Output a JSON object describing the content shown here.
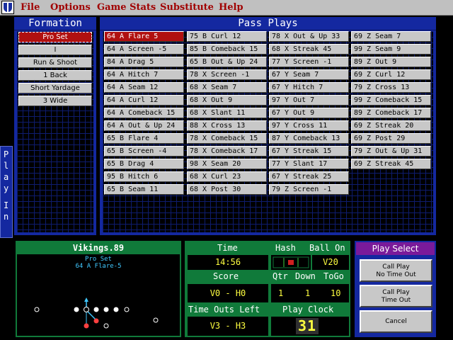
{
  "menu": {
    "items": [
      "File",
      "Options",
      "Game Stats",
      "Substitute",
      "Help"
    ]
  },
  "formation": {
    "title": "Formation",
    "items": [
      "Pro Set",
      "I",
      "Run & Shoot",
      "1 Back",
      "Short Yardage",
      "3 Wide"
    ],
    "selected_index": 0
  },
  "pass_plays": {
    "title": "Pass Plays",
    "columns": [
      [
        "64 A Flare 5",
        "64 A Screen -5",
        "84 A Drag 5",
        "64 A Hitch 7",
        "64 A Seam 12",
        "64 A Curl 12",
        "64 A Comeback 15",
        "64 A Out & Up 24",
        "65 B Flare 4",
        "65 B Screen -4",
        "65 B Drag 4",
        "95 B Hitch 6",
        "65 B Seam 11"
      ],
      [
        "75 B Curl 12",
        "85 B Comeback 15",
        "65 B Out & Up 24",
        "78 X Screen -1",
        "68 X Seam 7",
        "68 X Out 9",
        "68 X Slant 11",
        "88 X Cross 13",
        "78 X Comeback 15",
        "78 X Comeback 17",
        "98 X Seam 20",
        "68 X Curl 23",
        "68 X Post 30"
      ],
      [
        "78 X Out & Up 33",
        "68 X Streak 45",
        "77 Y Screen -1",
        "67 Y Seam 7",
        "67 Y Hitch 7",
        "97 Y Out 7",
        "67 Y Out 9",
        "97 Y Cross 11",
        "87 Y Comeback 13",
        "67 Y Streak 15",
        "77 Y Slant 17",
        "67 Y Streak 25",
        "79 Z Screen -1"
      ],
      [
        "69 Z Seam 7",
        "99 Z Seam 9",
        "89 Z Out 9",
        "69 Z Curl 12",
        "79 Z Cross 13",
        "99 Z Comeback 15",
        "89 Z Comeback 17",
        "69 Z Streak 20",
        "69 Z Post 29",
        "79 Z Out & Up 31",
        "69 Z Streak 45"
      ]
    ],
    "selected": "64 A Flare 5"
  },
  "play_in": {
    "label": "Play In"
  },
  "field": {
    "team": "Vikings.89",
    "formation": "Pro Set",
    "play": "64 A Flare-5"
  },
  "scoreboard": {
    "time_label": "Time",
    "time_value": "14:56",
    "hash_label": "Hash",
    "ballon_label": "Ball On",
    "ballon_value": "V20",
    "score_label": "Score",
    "score_value": "V0 - H0",
    "qtr_label": "Qtr",
    "qtr_value": "1",
    "down_label": "Down",
    "down_value": "1",
    "togo_label": "ToGo",
    "togo_value": "10",
    "timeouts_label": "Time Outs Left",
    "timeouts_value": "V3 - H3",
    "playclock_label": "Play Clock",
    "playclock_value": "31"
  },
  "play_select": {
    "title": "Play Select",
    "call_no_timeout": [
      "Call Play",
      "No Time Out"
    ],
    "call_timeout": [
      "Call Play",
      "Time Out"
    ],
    "cancel": "Cancel"
  },
  "colors": {
    "panel_blue": "#1428a0",
    "selected_red": "#b01010",
    "scoreboard_green": "#107a3a",
    "digit_yellow": "#ffff40",
    "menu_red": "#a00000",
    "play_select_purple": "#7a1a9a"
  }
}
